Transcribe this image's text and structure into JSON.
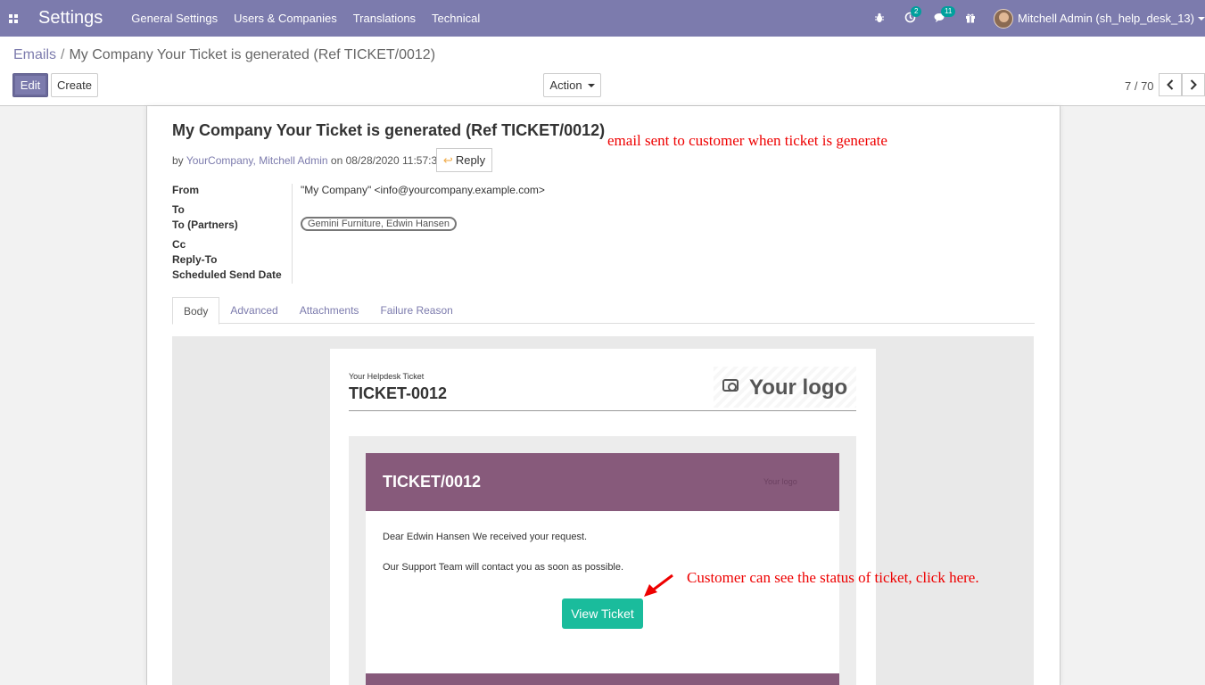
{
  "navbar": {
    "app_title": "Settings",
    "menu": [
      "General Settings",
      "Users & Companies",
      "Translations",
      "Technical"
    ],
    "activity_count": "2",
    "messages_count": "11",
    "user_name": "Mitchell Admin (sh_help_desk_13)",
    "accent_color": "#7c7bad"
  },
  "breadcrumb": {
    "parent": "Emails",
    "separator": "/",
    "current": "My Company Your Ticket is generated (Ref TICKET/0012)"
  },
  "toolbar": {
    "edit_label": "Edit",
    "create_label": "Create",
    "action_label": "Action",
    "pager": "7 / 70"
  },
  "record": {
    "subject": "My Company Your Ticket is generated (Ref TICKET/0012)",
    "by_prefix": "by",
    "authors": "YourCompany, Mitchell Admin",
    "on_text": "on 08/28/2020 11:57:33",
    "reply_label": "Reply",
    "fields": {
      "from_label": "From",
      "from_value": "\"My Company\" <info@yourcompany.example.com>",
      "to_label": "To",
      "to_partners_label": "To (Partners)",
      "to_partners_value": "Gemini Furniture, Edwin Hansen",
      "cc_label": "Cc",
      "reply_to_label": "Reply-To",
      "scheduled_label": "Scheduled Send Date"
    }
  },
  "tabs": [
    "Body",
    "Advanced",
    "Attachments",
    "Failure Reason"
  ],
  "email": {
    "small_header": "Your Helpdesk Ticket",
    "ticket_ref": "TICKET-0012",
    "logo_text": "Your logo",
    "card_title": "TICKET/0012",
    "card_logo": "Your logo",
    "dear_line": "Dear Edwin Hansen We received your request.",
    "support_line": "Our Support Team will contact you as soon as possible.",
    "view_button": "View Ticket",
    "button_color": "#1abc9c",
    "header_color": "#875a7b"
  },
  "annotations": {
    "note1": "email sent to customer when ticket is generate",
    "note2": "Customer can see the status of ticket, click here.",
    "color": "#ee0000"
  }
}
